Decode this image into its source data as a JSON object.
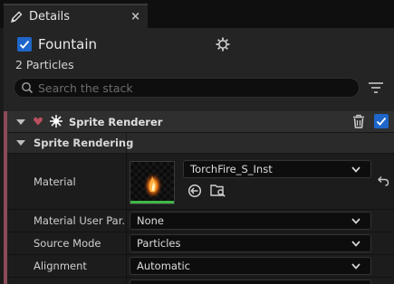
{
  "tab": {
    "title": "Details",
    "close_glyph": "×",
    "icon": "pencil-icon"
  },
  "emitter": {
    "name": "Fountain",
    "enabled": true,
    "particles": "2 Particles"
  },
  "search": {
    "placeholder": "Search the stack",
    "value": ""
  },
  "module": {
    "title": "Sprite Renderer",
    "enabled": true,
    "category": "Sprite Rendering",
    "properties": [
      {
        "label": "Material",
        "value": "TorchFire_S_Inst"
      },
      {
        "label": "Material User Par...",
        "value": "None"
      },
      {
        "label": "Source Mode",
        "value": "Particles"
      },
      {
        "label": "Alignment",
        "value": "Automatic"
      }
    ]
  },
  "colors": {
    "accent": "#1e66c9",
    "module_stripe": "#8c4a58",
    "thumbnail_bar": "#3fb848"
  }
}
